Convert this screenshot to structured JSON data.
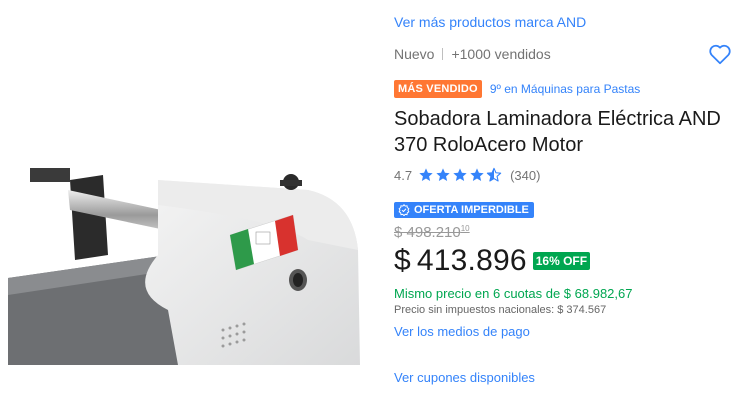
{
  "brand_link": "Ver más productos marca AND",
  "condition": {
    "state": "Nuevo",
    "sold": "+1000 vendidos"
  },
  "badges": {
    "best_seller": "MÁS VENDIDO",
    "rank": "9º en Máquinas para Pastas"
  },
  "title": "Sobadora Laminadora Eléctrica AND 370 RoloAcero Motor",
  "rating": {
    "value": "4.7",
    "stars_filled": 4.5,
    "count": "(340)"
  },
  "deal": {
    "label": "OFERTA IMPERDIBLE"
  },
  "prices": {
    "original": "$ 498.210",
    "original_cents": "10",
    "currency": "$",
    "current": "413.896",
    "discount": "16% OFF"
  },
  "installments": "Mismo precio en 6 cuotas de $ 68.982,67",
  "taxes": "Precio sin impuestos nacionales: $ 374.567",
  "payment_link": "Ver los medios de pago",
  "coupon_link": "Ver cupones disponibles",
  "colors": {
    "link": "#3483fa",
    "best_seller_badge": "#ff7733",
    "discount": "#00a650",
    "star": "#3483fa"
  },
  "icons": {
    "favorite": "heart-outline-icon",
    "deal": "gear-badge-icon",
    "star": "star-icon"
  }
}
